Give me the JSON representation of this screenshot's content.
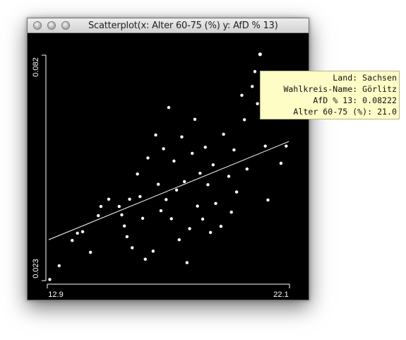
{
  "window": {
    "title": "Scatterplot(x: Alter 60-75 (%) y: AfD % 13)"
  },
  "tooltip": {
    "rows": [
      "Land: Sachsen",
      "Wahlkreis-Name: Görlitz",
      "AfD % 13: 0.08222",
      "Alter 60-75 (%): 21.0"
    ]
  },
  "chart_data": {
    "type": "scatter",
    "xlim": [
      12.9,
      22.1
    ],
    "ylim": [
      0.023,
      0.082
    ],
    "xtick_labels": [
      "12.9",
      "22.1"
    ],
    "ytick_labels": [
      "0.082",
      "0.023"
    ],
    "trend_line": {
      "x": [
        12.9,
        22.1
      ],
      "y": [
        0.0337,
        0.0594
      ]
    },
    "highlight": {
      "x": 21.0,
      "y": 0.08222
    },
    "points": [
      {
        "x": 12.94,
        "y": 0.0233
      },
      {
        "x": 13.3,
        "y": 0.0269
      },
      {
        "x": 13.8,
        "y": 0.0335
      },
      {
        "x": 14.0,
        "y": 0.0354
      },
      {
        "x": 14.2,
        "y": 0.0358
      },
      {
        "x": 14.5,
        "y": 0.0304
      },
      {
        "x": 14.9,
        "y": 0.0424
      },
      {
        "x": 14.8,
        "y": 0.04
      },
      {
        "x": 15.2,
        "y": 0.0443
      },
      {
        "x": 15.6,
        "y": 0.0424
      },
      {
        "x": 15.8,
        "y": 0.0373
      },
      {
        "x": 15.7,
        "y": 0.0402
      },
      {
        "x": 16.0,
        "y": 0.0443
      },
      {
        "x": 15.9,
        "y": 0.0345
      },
      {
        "x": 16.3,
        "y": 0.0509
      },
      {
        "x": 16.4,
        "y": 0.045
      },
      {
        "x": 16.5,
        "y": 0.0393
      },
      {
        "x": 16.1,
        "y": 0.0316
      },
      {
        "x": 16.6,
        "y": 0.0286
      },
      {
        "x": 16.9,
        "y": 0.0307
      },
      {
        "x": 16.7,
        "y": 0.0551
      },
      {
        "x": 17.0,
        "y": 0.0611
      },
      {
        "x": 17.1,
        "y": 0.0482
      },
      {
        "x": 17.2,
        "y": 0.0413
      },
      {
        "x": 17.3,
        "y": 0.0575
      },
      {
        "x": 17.4,
        "y": 0.0442
      },
      {
        "x": 17.5,
        "y": 0.0683
      },
      {
        "x": 17.6,
        "y": 0.0392
      },
      {
        "x": 17.7,
        "y": 0.0543
      },
      {
        "x": 17.8,
        "y": 0.0467
      },
      {
        "x": 17.9,
        "y": 0.0337
      },
      {
        "x": 18.0,
        "y": 0.0606
      },
      {
        "x": 18.1,
        "y": 0.0489
      },
      {
        "x": 18.2,
        "y": 0.0277
      },
      {
        "x": 18.3,
        "y": 0.0366
      },
      {
        "x": 18.4,
        "y": 0.0563
      },
      {
        "x": 18.5,
        "y": 0.0652
      },
      {
        "x": 18.6,
        "y": 0.0425
      },
      {
        "x": 18.7,
        "y": 0.0511
      },
      {
        "x": 18.8,
        "y": 0.0391
      },
      {
        "x": 18.9,
        "y": 0.0579
      },
      {
        "x": 19.0,
        "y": 0.0481
      },
      {
        "x": 19.1,
        "y": 0.0356
      },
      {
        "x": 19.2,
        "y": 0.0533
      },
      {
        "x": 19.3,
        "y": 0.0432
      },
      {
        "x": 19.5,
        "y": 0.0372
      },
      {
        "x": 19.6,
        "y": 0.0613
      },
      {
        "x": 19.8,
        "y": 0.0503
      },
      {
        "x": 19.9,
        "y": 0.0409
      },
      {
        "x": 20.0,
        "y": 0.0572
      },
      {
        "x": 20.1,
        "y": 0.0462
      },
      {
        "x": 20.3,
        "y": 0.0715
      },
      {
        "x": 20.4,
        "y": 0.0651
      },
      {
        "x": 20.5,
        "y": 0.0522
      },
      {
        "x": 20.7,
        "y": 0.0738
      },
      {
        "x": 20.8,
        "y": 0.0777
      },
      {
        "x": 20.9,
        "y": 0.0693
      },
      {
        "x": 21.2,
        "y": 0.0582
      },
      {
        "x": 21.3,
        "y": 0.0441
      },
      {
        "x": 21.5,
        "y": 0.0671
      },
      {
        "x": 21.8,
        "y": 0.0537
      },
      {
        "x": 22.0,
        "y": 0.0582
      }
    ]
  }
}
